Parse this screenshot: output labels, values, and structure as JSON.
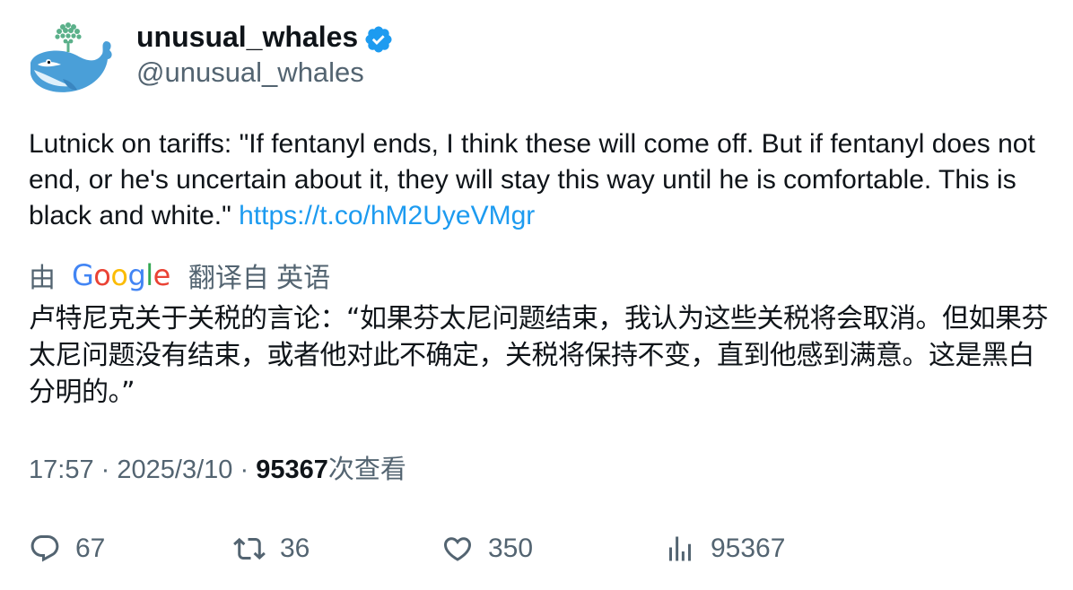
{
  "author": {
    "display_name": "unusual_whales",
    "handle": "@unusual_whales",
    "verified": true,
    "avatar_icon": "whale-logo-icon"
  },
  "tweet": {
    "text": "Lutnick on tariffs: \"If fentanyl ends, I think these will come off. But if fentanyl does not end, or he's uncertain about it, they will stay this way until he is comfortable. This is black and white.\" ",
    "link": "https://t.co/hM2UyeVMgr"
  },
  "translation": {
    "by_label": "由",
    "provider": "Google",
    "from_label": "翻译自 英语",
    "text": "卢特尼克关于关税的言论：“如果芬太尼问题结束，我认为这些关税将会取消。但如果芬太尼问题没有结束，或者他对此不确定，关税将保持不变，直到他感到满意。这是黑白分明的。”"
  },
  "meta": {
    "time": "17:57",
    "separator": "·",
    "date": "2025/3/10",
    "views_count": "95367",
    "views_label": "次查看"
  },
  "actions": {
    "replies": "67",
    "retweets": "36",
    "likes": "350",
    "views": "95367"
  },
  "colors": {
    "text": "#0f1419",
    "secondary": "#536471",
    "link": "#1d9bf0",
    "verified": "#1d9bf0"
  }
}
